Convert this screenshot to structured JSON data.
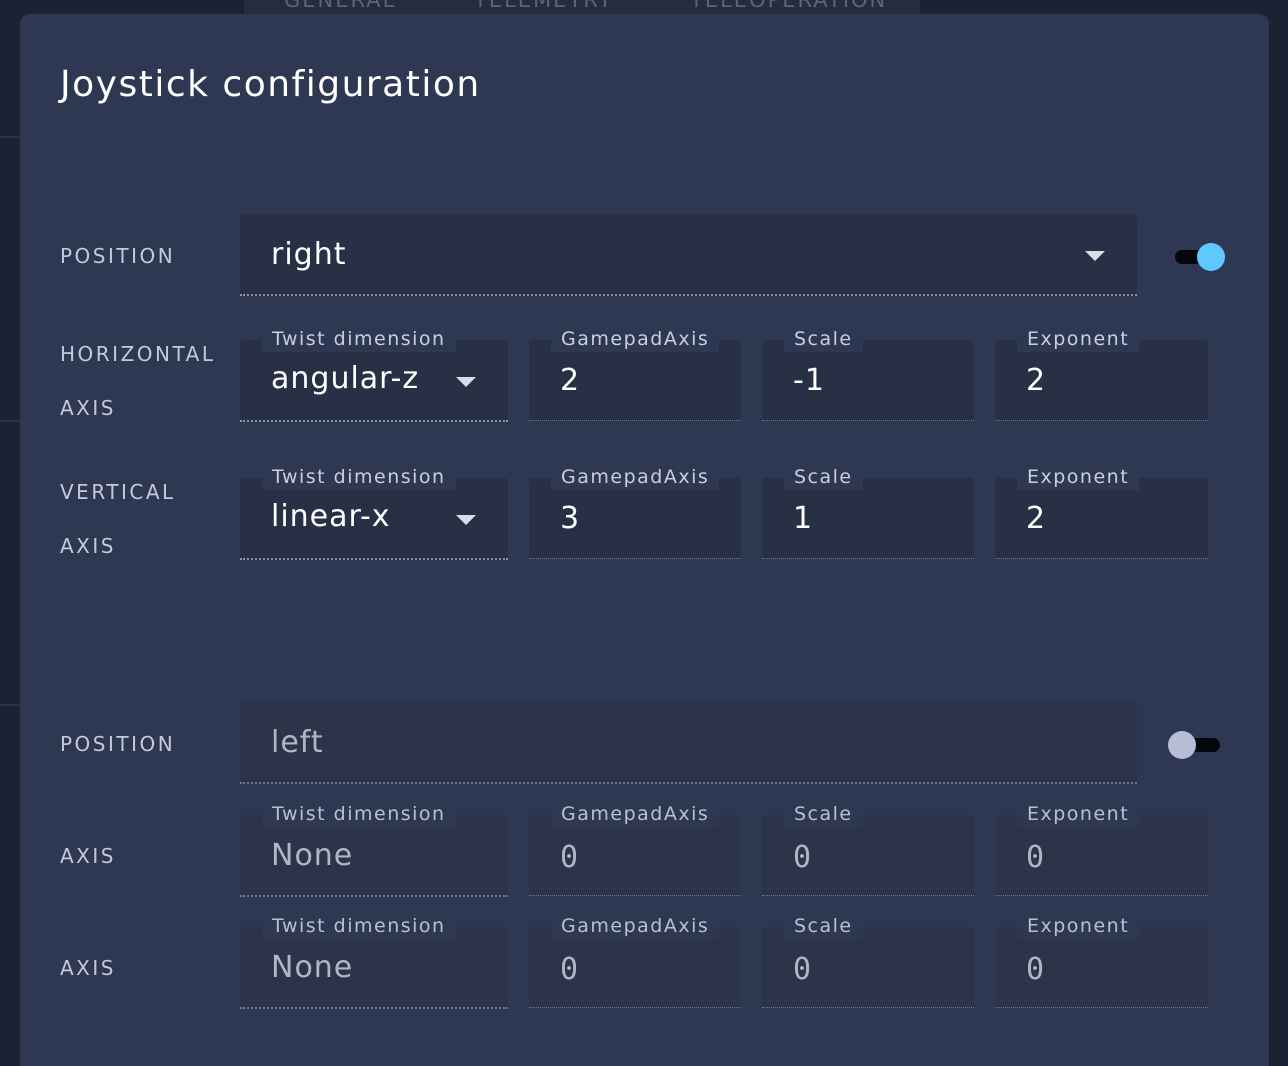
{
  "background_tabs": [
    "GENERAL",
    "TELEMETRY",
    "TELEOPERATION"
  ],
  "dialog": {
    "title": "Joystick configuration"
  },
  "joystick_right": {
    "position_label": "POSITION",
    "position_value": "right",
    "enabled": true,
    "horizontal_label_line1": "HORIZONTAL",
    "horizontal_label_line2": "AXIS",
    "vertical_label_line1": "VERTICAL",
    "vertical_label_line2": "AXIS",
    "field_labels": {
      "twist": "Twist dimension",
      "axis": "GamepadAxis",
      "scale": "Scale",
      "exponent": "Exponent"
    },
    "horizontal": {
      "twist": "angular-z",
      "axis": "2",
      "scale": "-1",
      "exponent": "2"
    },
    "vertical": {
      "twist": "linear-x",
      "axis": "3",
      "scale": "1",
      "exponent": "2"
    }
  },
  "joystick_left": {
    "position_label": "POSITION",
    "position_value": "left",
    "enabled": false,
    "axis1_label": "AXIS",
    "axis2_label": "AXIS",
    "field_labels": {
      "twist": "Twist dimension",
      "axis": "GamepadAxis",
      "scale": "Scale",
      "exponent": "Exponent"
    },
    "axis1": {
      "twist": "None",
      "axis": "0",
      "scale": "0",
      "exponent": "0"
    },
    "axis2": {
      "twist": "None",
      "axis": "0",
      "scale": "0",
      "exponent": "0"
    }
  },
  "colors": {
    "dialog_bg": "#2e3852",
    "field_bg": "#283045",
    "toggle_on": "#5ec8ff",
    "toggle_off": "#b7bdd6"
  }
}
